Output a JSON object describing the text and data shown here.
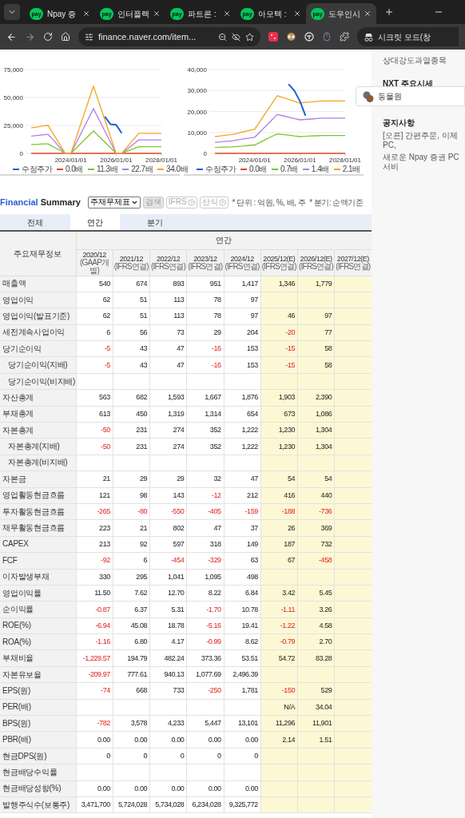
{
  "browser": {
    "tabs": [
      {
        "badge": "pay",
        "title": "Npay 증",
        "selected": false
      },
      {
        "badge": "pay",
        "title": "인터플렉",
        "selected": false
      },
      {
        "badge": "pay",
        "title": "파트론 :",
        "selected": false
      },
      {
        "badge": "pay",
        "title": "아모텍 :",
        "selected": false
      },
      {
        "badge": "pay",
        "title": "도우인시",
        "selected": true
      }
    ],
    "address": "finance.naver.com/item...",
    "profile_label": "시크릿 모드(창"
  },
  "charts": [
    {
      "chart_data": {
        "type": "line",
        "grid": true,
        "categories": [
          null,
          null,
          null,
          null,
          null,
          null,
          null,
          null,
          "2024/01/01",
          null,
          null,
          null,
          null,
          null,
          null,
          null,
          "2026/01/01",
          null,
          null,
          null,
          null,
          null,
          null,
          null,
          "2028/01/01"
        ],
        "ylim": [
          0,
          75000
        ],
        "yticks": [
          {
            "value": 0,
            "label": "0"
          },
          {
            "value": 25000,
            "label": "25,000"
          },
          {
            "value": 50000,
            "label": "50,000"
          },
          {
            "value": 75000,
            "label": "75,000"
          }
        ],
        "series": [
          {
            "name": "수정주가",
            "color": "#1e5fd8",
            "values": [
              null,
              null,
              null,
              null,
              null,
              null,
              null,
              null,
              null,
              null,
              null,
              null,
              null,
              null,
              33000,
              26000,
              25500,
              18000,
              null,
              null,
              null,
              null,
              null,
              null,
              null
            ]
          },
          {
            "name": "0.0배",
            "color": "#e0441f",
            "values": [
              null,
              0,
              0,
              0,
              0,
              0,
              0,
              0,
              0,
              0,
              0,
              0,
              0,
              0,
              0,
              0,
              0,
              0,
              0,
              0,
              0,
              0,
              0,
              0,
              0
            ]
          },
          {
            "name": "11.3배",
            "color": "#7cc52b",
            "values": [
              null,
              8000,
              8000,
              8500,
              8500,
              5500,
              3000,
              0,
              0,
              5000,
              10000,
              15000,
              20000,
              15000,
              10000,
              5000,
              0,
              0,
              2000,
              4000,
              6000,
              6000,
              6000,
              6000,
              6000
            ]
          },
          {
            "name": "22.7배",
            "color": "#b07de6",
            "values": [
              null,
              15500,
              16000,
              16500,
              17000,
              11500,
              5500,
              0,
              0,
              10000,
              20000,
              30000,
              40000,
              30000,
              20000,
              10000,
              0,
              0,
              4000,
              8000,
              12000,
              12000,
              12000,
              12000,
              12000
            ]
          },
          {
            "name": "34.0배",
            "color": "#f5a41f",
            "values": [
              null,
              23000,
              23500,
              24500,
              25000,
              16500,
              8500,
              0,
              0,
              15000,
              30000,
              45000,
              60000,
              45000,
              30000,
              15000,
              0,
              0,
              6000,
              12000,
              18000,
              18000,
              18000,
              18000,
              18000
            ]
          }
        ]
      }
    },
    {
      "chart_data": {
        "type": "line",
        "grid": true,
        "categories": [
          null,
          null,
          null,
          null,
          null,
          null,
          null,
          null,
          "2024/01/01",
          null,
          null,
          null,
          null,
          null,
          null,
          null,
          "2026/01/01",
          null,
          null,
          null,
          null,
          null,
          null,
          null,
          "2028/01/01"
        ],
        "ylim": [
          0,
          40000
        ],
        "yticks": [
          {
            "value": 0,
            "label": "0"
          },
          {
            "value": 10000,
            "label": "10,000"
          },
          {
            "value": 20000,
            "label": "20,000"
          },
          {
            "value": 30000,
            "label": "30,000"
          },
          {
            "value": 40000,
            "label": "40,000"
          }
        ],
        "series": [
          {
            "name": "수정주가",
            "color": "#1e5fd8",
            "values": [
              null,
              null,
              null,
              null,
              null,
              null,
              null,
              null,
              null,
              null,
              null,
              null,
              null,
              null,
              33000,
              30000,
              25000,
              18000,
              null,
              null,
              null,
              null,
              null,
              null,
              null
            ]
          },
          {
            "name": "0.0배",
            "color": "#e0441f",
            "values": [
              null,
              0,
              0,
              0,
              0,
              0,
              0,
              0,
              0,
              0,
              0,
              0,
              0,
              0,
              0,
              0,
              0,
              0,
              0,
              0,
              0,
              0,
              0,
              0,
              0
            ]
          },
          {
            "name": "0.7배",
            "color": "#7cc52b",
            "values": [
              null,
              2800,
              2900,
              3000,
              3100,
              3300,
              3500,
              3800,
              4000,
              5300,
              6700,
              8000,
              9300,
              9000,
              8700,
              8300,
              8000,
              8100,
              8300,
              8400,
              8500,
              8500,
              8500,
              8500,
              8500
            ]
          },
          {
            "name": "1.4배",
            "color": "#b07de6",
            "values": [
              null,
              5300,
              5500,
              5800,
              6000,
              6400,
              6900,
              7300,
              7700,
              10400,
              13100,
              15800,
              18500,
              17900,
              17300,
              16600,
              16000,
              16200,
              16400,
              16600,
              16800,
              16800,
              16800,
              16800,
              16800
            ]
          },
          {
            "name": "2.1배",
            "color": "#f5a41f",
            "values": [
              null,
              8000,
              8300,
              8700,
              9000,
              9600,
              10300,
              10900,
              11500,
              15500,
              19500,
              23500,
              27500,
              26600,
              25800,
              24900,
              24000,
              24300,
              24500,
              24800,
              25000,
              25000,
              25000,
              25000,
              25000
            ]
          }
        ]
      }
    }
  ],
  "sidebar": {
    "top_item": "상대강도과열종목",
    "nxt_title": "NXT 주요시세",
    "popup_label": "동물원",
    "notice_title": "공지사항",
    "notices": [
      "[오픈] 간편주문, 이제 PC,",
      "새로운 Npay 증권 PC 서비"
    ]
  },
  "summary": {
    "title_first": "Financial",
    "title_second": "Summary",
    "statement_select": "주재무제표",
    "buttons": [
      {
        "label": "검색",
        "disabled": true,
        "help": false
      },
      {
        "label": "IFRS",
        "disabled": false,
        "help": true
      },
      {
        "label": "산식",
        "disabled": false,
        "help": true
      }
    ],
    "notes": [
      "* 단위 : 억원, %, 배, 주",
      "* 분기: 순액기준"
    ],
    "tabs": [
      {
        "label": "전체",
        "selected": false
      },
      {
        "label": "연간",
        "selected": true
      },
      {
        "label": "분기",
        "selected": false
      }
    ],
    "table": {
      "corner": "주요재무정보",
      "group": "연간",
      "columns": [
        {
          "year": "2020/12",
          "basis": "(GAAP개별)",
          "estimate": false
        },
        {
          "year": "2021/12",
          "basis": "(IFRS연결)",
          "estimate": false
        },
        {
          "year": "2022/12",
          "basis": "(IFRS연결)",
          "estimate": false
        },
        {
          "year": "2023/12",
          "basis": "(IFRS연결)",
          "estimate": false
        },
        {
          "year": "2024/12",
          "basis": "(IFRS연결)",
          "estimate": false
        },
        {
          "year": "2025/12(E)",
          "basis": "(IFRS연결)",
          "estimate": true
        },
        {
          "year": "2026/12(E)",
          "basis": "(IFRS연결)",
          "estimate": true
        },
        {
          "year": "2027/12(E)",
          "basis": "(IFRS연결)",
          "estimate": true
        }
      ],
      "rows": [
        {
          "label": "매출액",
          "cells": [
            {
              "text": "540",
              "negative": false
            },
            {
              "text": "674",
              "negative": false
            },
            {
              "text": "893",
              "negative": false
            },
            {
              "text": "951",
              "negative": false
            },
            {
              "text": "1,417",
              "negative": false
            },
            {
              "text": "1,346",
              "negative": false
            },
            {
              "text": "1,779",
              "negative": false
            },
            {}
          ]
        },
        {
          "label": "영업이익",
          "cells": [
            {
              "text": "62",
              "negative": false
            },
            {
              "text": "51",
              "negative": false
            },
            {
              "text": "113",
              "negative": false
            },
            {
              "text": "78",
              "negative": false
            },
            {
              "text": "97",
              "negative": false
            },
            {},
            {},
            {}
          ]
        },
        {
          "label": "영업이익(발표기준)",
          "cells": [
            {
              "text": "62",
              "negative": false
            },
            {
              "text": "51",
              "negative": false
            },
            {
              "text": "113",
              "negative": false
            },
            {
              "text": "78",
              "negative": false
            },
            {
              "text": "97",
              "negative": false
            },
            {
              "text": "46",
              "negative": false
            },
            {
              "text": "97",
              "negative": false
            },
            {}
          ]
        },
        {
          "label": "세전계속사업이익",
          "cells": [
            {
              "text": "6",
              "negative": false
            },
            {
              "text": "56",
              "negative": false
            },
            {
              "text": "73",
              "negative": false
            },
            {
              "text": "29",
              "negative": false
            },
            {
              "text": "204",
              "negative": false
            },
            {
              "text": "-20",
              "negative": true
            },
            {
              "text": "77",
              "negative": false
            },
            {}
          ]
        },
        {
          "label": "당기순이익",
          "cells": [
            {
              "text": "-5",
              "negative": true
            },
            {
              "text": "43",
              "negative": false
            },
            {
              "text": "47",
              "negative": false
            },
            {
              "text": "-16",
              "negative": true
            },
            {
              "text": "153",
              "negative": false
            },
            {
              "text": "-15",
              "negative": true
            },
            {
              "text": "58",
              "negative": false
            },
            {}
          ],
          "children": [
            {
              "label": "당기순이익(지배)",
              "cells": [
                {
                  "text": "-5",
                  "negative": true
                },
                {
                  "text": "43",
                  "negative": false
                },
                {
                  "text": "47",
                  "negative": false
                },
                {
                  "text": "-16",
                  "negative": true
                },
                {
                  "text": "153",
                  "negative": false
                },
                {
                  "text": "-15",
                  "negative": true
                },
                {
                  "text": "58",
                  "negative": false
                },
                {}
              ]
            },
            {
              "label": "당기순이익(비지배)",
              "cells": [
                {},
                {},
                {},
                {},
                {},
                {},
                {},
                {}
              ]
            }
          ]
        },
        {
          "label": "자산총계",
          "cells": [
            {
              "text": "563",
              "negative": false
            },
            {
              "text": "682",
              "negative": false
            },
            {
              "text": "1,593",
              "negative": false
            },
            {
              "text": "1,667",
              "negative": false
            },
            {
              "text": "1,876",
              "negative": false
            },
            {
              "text": "1,903",
              "negative": false
            },
            {
              "text": "2,390",
              "negative": false
            },
            {}
          ]
        },
        {
          "label": "부채총계",
          "cells": [
            {
              "text": "613",
              "negative": false
            },
            {
              "text": "450",
              "negative": false
            },
            {
              "text": "1,319",
              "negative": false
            },
            {
              "text": "1,314",
              "negative": false
            },
            {
              "text": "654",
              "negative": false
            },
            {
              "text": "673",
              "negative": false
            },
            {
              "text": "1,086",
              "negative": false
            },
            {}
          ]
        },
        {
          "label": "자본총계",
          "cells": [
            {
              "text": "-50",
              "negative": true
            },
            {
              "text": "231",
              "negative": false
            },
            {
              "text": "274",
              "negative": false
            },
            {
              "text": "352",
              "negative": false
            },
            {
              "text": "1,222",
              "negative": false
            },
            {
              "text": "1,230",
              "negative": false
            },
            {
              "text": "1,304",
              "negative": false
            },
            {}
          ],
          "children": [
            {
              "label": "자본총계(지배)",
              "cells": [
                {
                  "text": "-50",
                  "negative": true
                },
                {
                  "text": "231",
                  "negative": false
                },
                {
                  "text": "274",
                  "negative": false
                },
                {
                  "text": "352",
                  "negative": false
                },
                {
                  "text": "1,222",
                  "negative": false
                },
                {
                  "text": "1,230",
                  "negative": false
                },
                {
                  "text": "1,304",
                  "negative": false
                },
                {}
              ]
            },
            {
              "label": "자본총계(비지배)",
              "cells": [
                {},
                {},
                {},
                {},
                {},
                {},
                {},
                {}
              ]
            }
          ]
        },
        {
          "label": "자본금",
          "cells": [
            {
              "text": "21",
              "negative": false
            },
            {
              "text": "29",
              "negative": false
            },
            {
              "text": "29",
              "negative": false
            },
            {
              "text": "32",
              "negative": false
            },
            {
              "text": "47",
              "negative": false
            },
            {
              "text": "54",
              "negative": false
            },
            {
              "text": "54",
              "negative": false
            },
            {}
          ]
        },
        {
          "label": "영업활동현금흐름",
          "cells": [
            {
              "text": "121",
              "negative": false
            },
            {
              "text": "98",
              "negative": false
            },
            {
              "text": "143",
              "negative": false
            },
            {
              "text": "-12",
              "negative": true
            },
            {
              "text": "212",
              "negative": false
            },
            {
              "text": "416",
              "negative": false
            },
            {
              "text": "440",
              "negative": false
            },
            {}
          ]
        },
        {
          "label": "투자활동현금흐름",
          "cells": [
            {
              "text": "-265",
              "negative": true
            },
            {
              "text": "-80",
              "negative": true
            },
            {
              "text": "-550",
              "negative": true
            },
            {
              "text": "-405",
              "negative": true
            },
            {
              "text": "-159",
              "negative": true
            },
            {
              "text": "-188",
              "negative": true
            },
            {
              "text": "-736",
              "negative": true
            },
            {}
          ]
        },
        {
          "label": "재무활동현금흐름",
          "cells": [
            {
              "text": "223",
              "negative": false
            },
            {
              "text": "21",
              "negative": false
            },
            {
              "text": "802",
              "negative": false
            },
            {
              "text": "47",
              "negative": false
            },
            {
              "text": "37",
              "negative": false
            },
            {
              "text": "26",
              "negative": false
            },
            {
              "text": "369",
              "negative": false
            },
            {}
          ]
        },
        {
          "label": "CAPEX",
          "cells": [
            {
              "text": "213",
              "negative": false
            },
            {
              "text": "92",
              "negative": false
            },
            {
              "text": "597",
              "negative": false
            },
            {
              "text": "318",
              "negative": false
            },
            {
              "text": "149",
              "negative": false
            },
            {
              "text": "187",
              "negative": false
            },
            {
              "text": "732",
              "negative": false
            },
            {}
          ]
        },
        {
          "label": "FCF",
          "cells": [
            {
              "text": "-92",
              "negative": true
            },
            {
              "text": "6",
              "negative": false
            },
            {
              "text": "-454",
              "negative": true
            },
            {
              "text": "-329",
              "negative": true
            },
            {
              "text": "63",
              "negative": false
            },
            {
              "text": "67",
              "negative": false
            },
            {
              "text": "-458",
              "negative": true
            },
            {}
          ]
        },
        {
          "label": "이자발생부채",
          "cells": [
            {
              "text": "330",
              "negative": false
            },
            {
              "text": "295",
              "negative": false
            },
            {
              "text": "1,041",
              "negative": false
            },
            {
              "text": "1,095",
              "negative": false
            },
            {
              "text": "498",
              "negative": false
            },
            {},
            {},
            {}
          ]
        },
        {
          "label": "영업이익률",
          "cells": [
            {
              "text": "11.50",
              "negative": false
            },
            {
              "text": "7.62",
              "negative": false
            },
            {
              "text": "12.70",
              "negative": false
            },
            {
              "text": "8.22",
              "negative": false
            },
            {
              "text": "6.84",
              "negative": false
            },
            {
              "text": "3.42",
              "negative": false
            },
            {
              "text": "5.45",
              "negative": false
            },
            {}
          ]
        },
        {
          "label": "순이익률",
          "cells": [
            {
              "text": "-0.87",
              "negative": true
            },
            {
              "text": "6.37",
              "negative": false
            },
            {
              "text": "5.31",
              "negative": false
            },
            {
              "text": "-1.70",
              "negative": true
            },
            {
              "text": "10.78",
              "negative": false
            },
            {
              "text": "-1.11",
              "negative": true
            },
            {
              "text": "3.26",
              "negative": false
            },
            {}
          ]
        },
        {
          "label": "ROE(%)",
          "cells": [
            {
              "text": "-6.94",
              "negative": true
            },
            {
              "text": "45.08",
              "negative": false
            },
            {
              "text": "18.78",
              "negative": false
            },
            {
              "text": "-5.16",
              "negative": true
            },
            {
              "text": "19.41",
              "negative": false
            },
            {
              "text": "-1.22",
              "negative": true
            },
            {
              "text": "4.58",
              "negative": false
            },
            {}
          ]
        },
        {
          "label": "ROA(%)",
          "cells": [
            {
              "text": "-1.16",
              "negative": true
            },
            {
              "text": "6.80",
              "negative": false
            },
            {
              "text": "4.17",
              "negative": false
            },
            {
              "text": "-0.99",
              "negative": true
            },
            {
              "text": "8.62",
              "negative": false
            },
            {
              "text": "-0.79",
              "negative": true
            },
            {
              "text": "2.70",
              "negative": false
            },
            {}
          ]
        },
        {
          "label": "부채비율",
          "cells": [
            {
              "text": "-1,229.57",
              "negative": true
            },
            {
              "text": "194.79",
              "negative": false
            },
            {
              "text": "482.24",
              "negative": false
            },
            {
              "text": "373.36",
              "negative": false
            },
            {
              "text": "53.51",
              "negative": false
            },
            {
              "text": "54.72",
              "negative": false
            },
            {
              "text": "83.28",
              "negative": false
            },
            {}
          ]
        },
        {
          "label": "자본유보율",
          "cells": [
            {
              "text": "-209.97",
              "negative": true
            },
            {
              "text": "777.61",
              "negative": false
            },
            {
              "text": "940.13",
              "negative": false
            },
            {
              "text": "1,077.69",
              "negative": false
            },
            {
              "text": "2,496.39",
              "negative": false
            },
            {},
            {},
            {}
          ]
        },
        {
          "label": "EPS(원)",
          "cells": [
            {
              "text": "-74",
              "negative": true
            },
            {
              "text": "668",
              "negative": false
            },
            {
              "text": "733",
              "negative": false
            },
            {
              "text": "-250",
              "negative": true
            },
            {
              "text": "1,781",
              "negative": false
            },
            {
              "text": "-150",
              "negative": true
            },
            {
              "text": "529",
              "negative": false
            },
            {}
          ]
        },
        {
          "label": "PER(배)",
          "cells": [
            {},
            {},
            {},
            {},
            {},
            {
              "text": "N/A",
              "negative": false
            },
            {
              "text": "34.04",
              "negative": false
            },
            {}
          ]
        },
        {
          "label": "BPS(원)",
          "cells": [
            {
              "text": "-782",
              "negative": true
            },
            {
              "text": "3,578",
              "negative": false
            },
            {
              "text": "4,233",
              "negative": false
            },
            {
              "text": "5,447",
              "negative": false
            },
            {
              "text": "13,101",
              "negative": false
            },
            {
              "text": "11,296",
              "negative": false
            },
            {
              "text": "11,901",
              "negative": false
            },
            {}
          ]
        },
        {
          "label": "PBR(배)",
          "cells": [
            {
              "text": "0.00",
              "negative": false
            },
            {
              "text": "0.00",
              "negative": false
            },
            {
              "text": "0.00",
              "negative": false
            },
            {
              "text": "0.00",
              "negative": false
            },
            {
              "text": "0.00",
              "negative": false
            },
            {
              "text": "2.14",
              "negative": false
            },
            {
              "text": "1.51",
              "negative": false
            },
            {}
          ]
        },
        {
          "label": "현금DPS(원)",
          "cells": [
            {
              "text": "0",
              "negative": false
            },
            {
              "text": "0",
              "negative": false
            },
            {
              "text": "0",
              "negative": false
            },
            {
              "text": "0",
              "negative": false
            },
            {
              "text": "0",
              "negative": false
            },
            {},
            {},
            {}
          ]
        },
        {
          "label": "현금배당수익률",
          "cells": [
            {},
            {},
            {},
            {},
            {},
            {},
            {},
            {}
          ]
        },
        {
          "label": "현금배당성향(%)",
          "cells": [
            {
              "text": "0.00",
              "negative": false
            },
            {
              "text": "0.00",
              "negative": false
            },
            {
              "text": "0.00",
              "negative": false
            },
            {
              "text": "0.00",
              "negative": false
            },
            {
              "text": "0.00",
              "negative": false
            },
            {},
            {},
            {}
          ]
        },
        {
          "label": "발행주식수(보통주)",
          "cells": [
            {
              "text": "3,471,700",
              "negative": false
            },
            {
              "text": "5,724,028",
              "negative": false
            },
            {
              "text": "5,734,028",
              "negative": false
            },
            {
              "text": "6,234,028",
              "negative": false
            },
            {
              "text": "9,325,772",
              "negative": false
            },
            {},
            {},
            {}
          ]
        }
      ]
    }
  }
}
